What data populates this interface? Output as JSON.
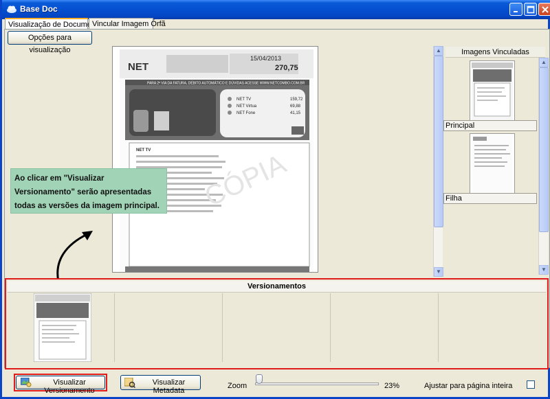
{
  "window": {
    "title": "Base Doc"
  },
  "tabs": [
    {
      "label": "Visualização de Documentos"
    },
    {
      "label": "Vincular Imagem Órfã"
    }
  ],
  "toolbar": {
    "view_options_label": "Opções para visualização"
  },
  "document": {
    "brand": "NET",
    "date": "15/04/2013",
    "amount": "270,75",
    "banner": "PARA 2ª VIA DA FATURA, DÉBITO AUTOMÁTICO E DÚVIDAS ACESSE WWW.NETCOMBO.COM.BR",
    "services": [
      {
        "name": "NET TV",
        "value": "159,72"
      },
      {
        "name": "NET Virtua",
        "value": "69,88"
      },
      {
        "name": "NET Fone",
        "value": "41,15"
      }
    ],
    "section_title": "NET TV",
    "watermark": "CÓPIA"
  },
  "linked_images": {
    "header": "Imagens Vinculadas",
    "items": [
      {
        "label": "Principal"
      },
      {
        "label": "Filha"
      }
    ]
  },
  "versions": {
    "header": "Versionamentos"
  },
  "callout": {
    "text": "Ao clicar em \"Visualizar Versionamento\" serão apresentadas todas as versões da imagem principal."
  },
  "bottom": {
    "versioning_button": "Visualizar Versionamento",
    "metadata_button": "Visualizar Metadata",
    "zoom_label": "Zoom",
    "zoom_value": "23%",
    "fit_label": "Ajustar para página inteira",
    "fit_checked": false
  },
  "colors": {
    "title_bar": "#0450d0",
    "highlight": "#e11a1a",
    "callout_bg": "#a1d3b6"
  }
}
